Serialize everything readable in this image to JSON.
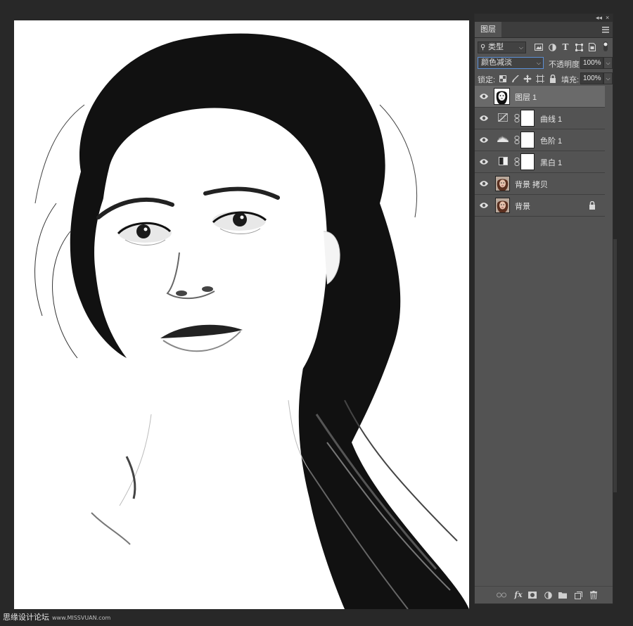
{
  "panel": {
    "tab_label": "图层",
    "collapse_glyph": "◂◂",
    "close_glyph": "×",
    "filter": {
      "value": "类型",
      "search_icon": "search-icon"
    },
    "filter_icons": [
      "image-filter-icon",
      "adjustment-filter-icon",
      "type-filter-icon",
      "shape-filter-icon",
      "smart-object-filter-icon",
      "filter-toggle-icon"
    ],
    "blend_mode": "颜色减淡",
    "opacity": {
      "label": "不透明度:",
      "value": "100%"
    },
    "lock": {
      "label": "锁定:"
    },
    "fill": {
      "label": "填充:",
      "value": "100%"
    }
  },
  "layers": [
    {
      "name": "图层 1",
      "kind": "pixel-bw",
      "selected": true,
      "visible": true
    },
    {
      "name": "曲线 1",
      "kind": "adjustment",
      "icon": "curves-icon",
      "visible": true
    },
    {
      "name": "色阶 1",
      "kind": "adjustment",
      "icon": "levels-icon",
      "visible": true
    },
    {
      "name": "黑白 1",
      "kind": "adjustment",
      "icon": "black-white-icon",
      "visible": true
    },
    {
      "name": "背景 拷贝",
      "kind": "pixel-color",
      "visible": true
    },
    {
      "name": "背景",
      "kind": "pixel-color",
      "locked": true,
      "visible": true
    }
  ],
  "bottom_icons": [
    "link-layers-icon",
    "fx-icon",
    "add-mask-icon",
    "new-adjustment-icon",
    "new-group-icon",
    "new-layer-icon",
    "delete-icon"
  ],
  "watermark": {
    "text": "思缘设计论坛",
    "url": "www.MISSVUAN.com"
  }
}
